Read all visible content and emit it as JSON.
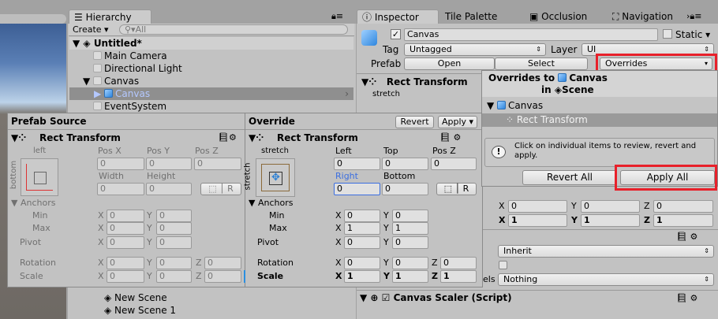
{
  "hierarchy": {
    "tab": "Hierarchy",
    "create": "Create",
    "search_placeholder": "All",
    "scene": "Untitled*",
    "items": [
      "Main Camera",
      "Directional Light",
      "Canvas",
      "Canvas",
      "EventSystem"
    ],
    "scenes": [
      "New Scene",
      "New Scene 1"
    ]
  },
  "inspector": {
    "tabs": [
      "Inspector",
      "Tile Palette",
      "Occlusion",
      "Navigation"
    ],
    "name": "Canvas",
    "static": "Static",
    "tag_label": "Tag",
    "tag": "Untagged",
    "layer_label": "Layer",
    "layer": "UI",
    "prefab_label": "Prefab",
    "open": "Open",
    "select": "Select",
    "overrides": "Overrides",
    "component": "Rect Transform",
    "stretch": "stretch",
    "rows": {
      "x0": "0",
      "y0": "0",
      "z0": "0",
      "x1": "1",
      "y1": "1",
      "z1": "1"
    },
    "render_mode": "Inherit",
    "layers_label": "els",
    "layers": "Nothing",
    "scaler": "Canvas Scaler (Script)"
  },
  "source": {
    "title": "Prefab Source",
    "component": "Rect Transform",
    "anchor_top": "left",
    "anchor_side": "bottom",
    "h1": [
      "Pos X",
      "Pos Y",
      "Pos Z"
    ],
    "v1": [
      "0",
      "0",
      "0"
    ],
    "h2": [
      "Width",
      "Height"
    ],
    "v2": [
      "0",
      "0"
    ],
    "r": "R",
    "anchors": "Anchors",
    "min": "Min",
    "max": "Max",
    "pivot": "Pivot",
    "rotation": "Rotation",
    "scale": "Scale",
    "min_v": [
      "0",
      "0"
    ],
    "max_v": [
      "0",
      "0"
    ],
    "pivot_v": [
      "0",
      "0"
    ],
    "rot_v": [
      "0",
      "0",
      "0"
    ],
    "scale_v": [
      "0",
      "0",
      "0"
    ]
  },
  "override": {
    "title": "Override",
    "revert": "Revert",
    "apply": "Apply",
    "component": "Rect Transform",
    "anchor_top": "stretch",
    "anchor_side": "stretch",
    "h1": [
      "Left",
      "Top",
      "Pos Z"
    ],
    "v1": [
      "0",
      "0",
      "0"
    ],
    "h2": [
      "Right",
      "Bottom"
    ],
    "v2": [
      "0",
      "0"
    ],
    "r": "R",
    "anchors": "Anchors",
    "min": "Min",
    "max": "Max",
    "pivot": "Pivot",
    "rotation": "Rotation",
    "scale": "Scale",
    "min_v": [
      "0",
      "0"
    ],
    "max_v": [
      "1",
      "1"
    ],
    "pivot_v": [
      "0",
      "0"
    ],
    "rot_v": [
      "0",
      "0",
      "0"
    ],
    "scale_v": [
      "1",
      "1",
      "1"
    ]
  },
  "overrides_popup": {
    "title_a": "Overrides to",
    "title_obj": "Canvas",
    "title_b": "in",
    "title_scene": "Scene",
    "tree_root": "Canvas",
    "tree_child": "Rect Transform",
    "info": "Click on individual items to review, revert and apply.",
    "revert_all": "Revert All",
    "apply_all": "Apply All"
  },
  "axes": {
    "x": "X",
    "y": "Y",
    "z": "Z"
  },
  "colors": {
    "highlight": "#e8202a",
    "selected_text": "#3b6ee0"
  }
}
